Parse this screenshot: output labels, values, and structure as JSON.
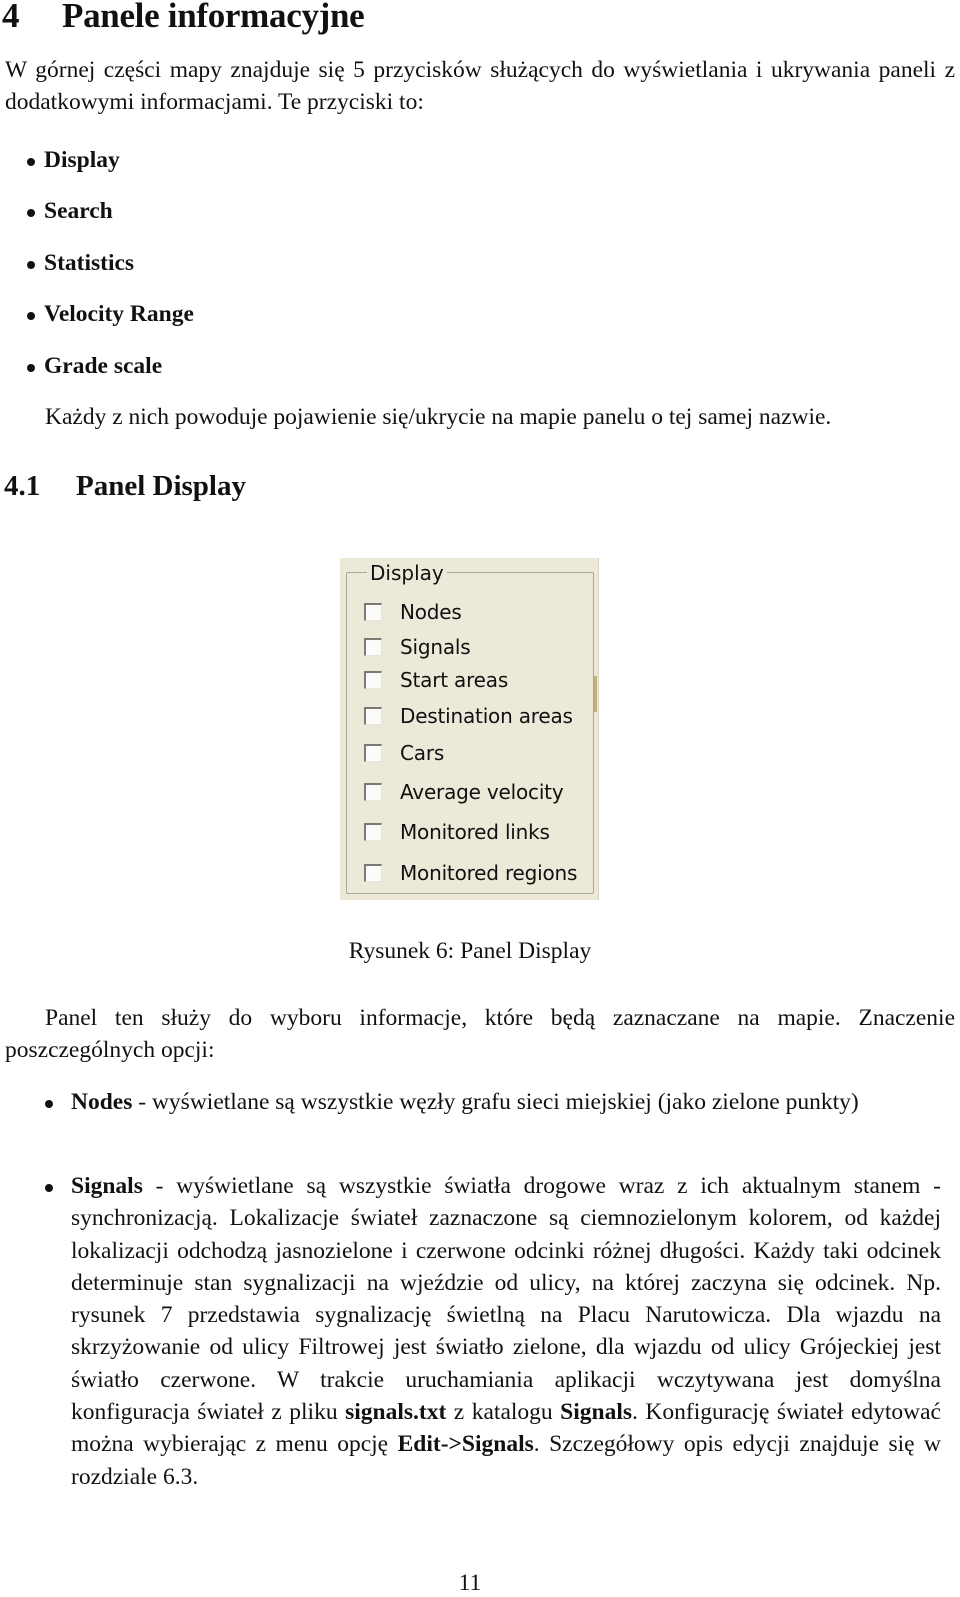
{
  "section": {
    "number": "4",
    "title": "Panele informacyjne"
  },
  "intro": "W górnej części mapy znajduje się 5 przycisków służących do wyświetlania i ukrywania paneli z dodatkowymi informacjami. Te przyciski to:",
  "buttons_list": [
    "Display",
    "Search",
    "Statistics",
    "Velocity Range",
    "Grade scale"
  ],
  "after_list": "Każdy z nich powoduje pojawienie się/ukrycie na mapie panelu o tej samej nazwie.",
  "subsection": {
    "number": "4.1",
    "title": "Panel Display"
  },
  "figure": {
    "groupbox_label": "Display",
    "checkboxes": [
      {
        "label": "Nodes",
        "checked": false
      },
      {
        "label": "Signals",
        "checked": false
      },
      {
        "label": "Start areas",
        "checked": false
      },
      {
        "label": "Destination areas",
        "checked": false
      },
      {
        "label": "Cars",
        "checked": false
      },
      {
        "label": "Average velocity",
        "checked": false
      },
      {
        "label": "Monitored links",
        "checked": false
      },
      {
        "label": "Monitored regions",
        "checked": false
      }
    ],
    "caption": "Rysunek 6: Panel Display"
  },
  "panel_desc": "Panel ten służy do wyboru informacje, które będą zaznaczane na mapie. Znaczenie poszczególnych opcji:",
  "options": [
    {
      "term": "Nodes",
      "text": " - wyświetlane są wszystkie węzły grafu sieci miejskiej (jako zielone punkty)"
    },
    {
      "term": "Signals",
      "text_1": " - wyświetlane są wszystkie światła drogowe wraz z ich aktualnym stanem - synchronizacją. Lokalizacje świateł zaznaczone są ciemnozielonym kolorem, od każdej lokalizacji odchodzą jasnozielone i czerwone odcinki różnej długości. Każdy taki odcinek determinuje stan sygnalizacji na wjeździe od ulicy, na której zaczyna się odcinek. Np. rysunek 7 przedstawia sygnalizację świetlną na Placu Narutowicza. Dla wjazdu na skrzyżowanie od ulicy Filtrowej jest światło zielone, dla wjazdu od ulicy Grójeckiej jest światło czerwone. W trakcie uruchamiania aplikacji wczytywana jest domyślna konfiguracja świateł z pliku ",
      "file": "signals.txt",
      "text_2": " z katalogu ",
      "folder": "Signals",
      "text_3": ". Konfigurację świateł edytować można wybierając z menu opcję ",
      "menu": "Edit->Signals",
      "text_4": ". Szczegółowy opis edycji znajduje się w rozdziale 6.3."
    }
  ],
  "page_number": "11"
}
